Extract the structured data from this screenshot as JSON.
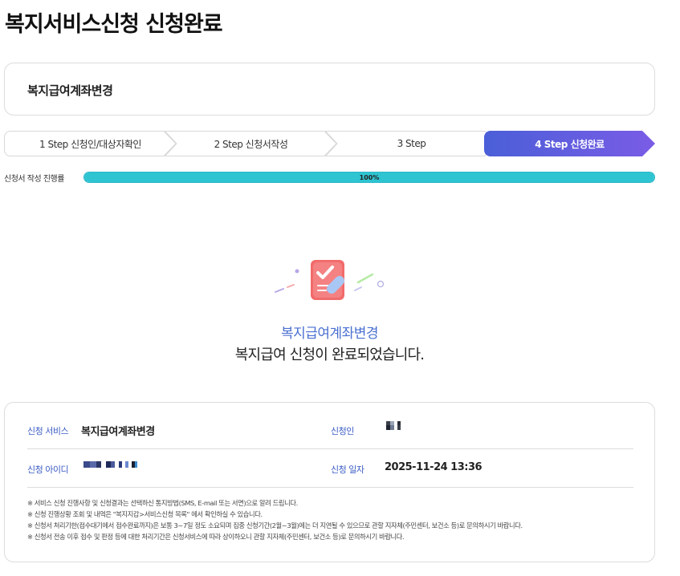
{
  "page": {
    "title": "복지서비스신청 신청완료"
  },
  "service": {
    "name": "복지급여계좌변경"
  },
  "steps": [
    {
      "label": "1 Step 신청인/대상자확인",
      "active": false
    },
    {
      "label": "2 Step 신청서작성",
      "active": false
    },
    {
      "label": "3 Step",
      "active": false
    },
    {
      "label": "4 Step 신청완료",
      "active": true
    }
  ],
  "progress": {
    "label": "신청서 작성 진행률",
    "value": 100,
    "text": "100%"
  },
  "completion": {
    "service_name": "복지급여계좌변경",
    "message": "복지급여 신청이 완료되었습니다."
  },
  "info": {
    "service_label": "신청 서비스",
    "service_value": "복지급여계좌변경",
    "applicant_label": "신청인",
    "id_label": "신청 아이디",
    "date_label": "신청 일자",
    "date_value": "2025-11-24 13:36"
  },
  "notes": [
    "※ 서비스 신청 진행사항 및 신청결과는 선택하신 통지방법(SMS, E-mail 또는 서면)으로 알려 드립니다.",
    "※ 신청 진행상황 조회 및 내역은 \"복지지갑>서비스신청 목록\" 에서 확인하실 수 있습니다.",
    "※ 신청서 처리기한(접수대기에서 접수완료까지)은 보통 3~7일 정도 소요되며 집중 신청기간(2월~3월)에는 더 지연될 수 있으므로 관할 지자체(주민센터, 보건소 등)로 문의하시기 바랍니다.",
    "※ 신청서 전송 이후 접수 및 판정 등에 대한 처리기간은 신청서비스에 따라 상이하오니 관할 지자체(주민센터, 보건소 등)로 문의하시기 바랍니다."
  ],
  "colors": {
    "accent": "#4a6fd1",
    "progress": "#2ec4d2",
    "step_active_start": "#4a5fd8",
    "step_active_end": "#7a5ce6"
  }
}
